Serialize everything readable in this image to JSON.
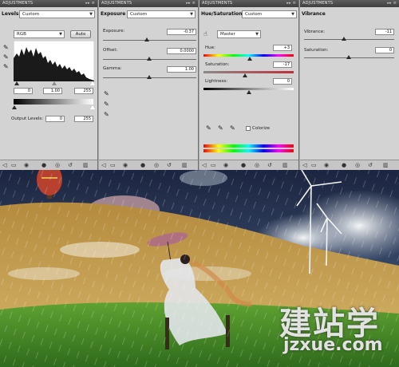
{
  "tabs": {
    "adjustments": "ADJUSTMENTS"
  },
  "levels": {
    "title": "Levels:",
    "preset": "Custom",
    "channel": "RGB",
    "auto_label": "Auto",
    "input_black": "0",
    "input_gamma": "1.00",
    "input_white": "255",
    "output_label": "Output Levels:",
    "output_black": "0",
    "output_white": "255"
  },
  "exposure": {
    "title": "Exposure",
    "preset": "Custom",
    "exposure_label": "Exposure:",
    "exposure_value": "-0.37",
    "offset_label": "Offset:",
    "offset_value": "0.0000",
    "gamma_label": "Gamma:",
    "gamma_value": "1.00"
  },
  "huesat": {
    "title": "Hue/Saturation",
    "preset": "Custom",
    "channel": "Master",
    "hue_label": "Hue:",
    "hue_value": "+3",
    "sat_label": "Saturation:",
    "sat_value": "-17",
    "light_label": "Lightness:",
    "light_value": "0",
    "colorize_label": "Colorize"
  },
  "vibrance": {
    "title": "Vibrance",
    "vibrance_label": "Vibrance:",
    "vibrance_value": "-11",
    "sat_label": "Saturation:",
    "sat_value": "0"
  },
  "watermark": {
    "chinese": "建站学",
    "url": "jzxue.com"
  },
  "colors": {
    "tab_bg": "#4a4a4a",
    "panel_bg": "#d3d3d3",
    "sky": "#2c3c5a",
    "field": "#c9a75a",
    "grass": "#4c8a2a"
  }
}
